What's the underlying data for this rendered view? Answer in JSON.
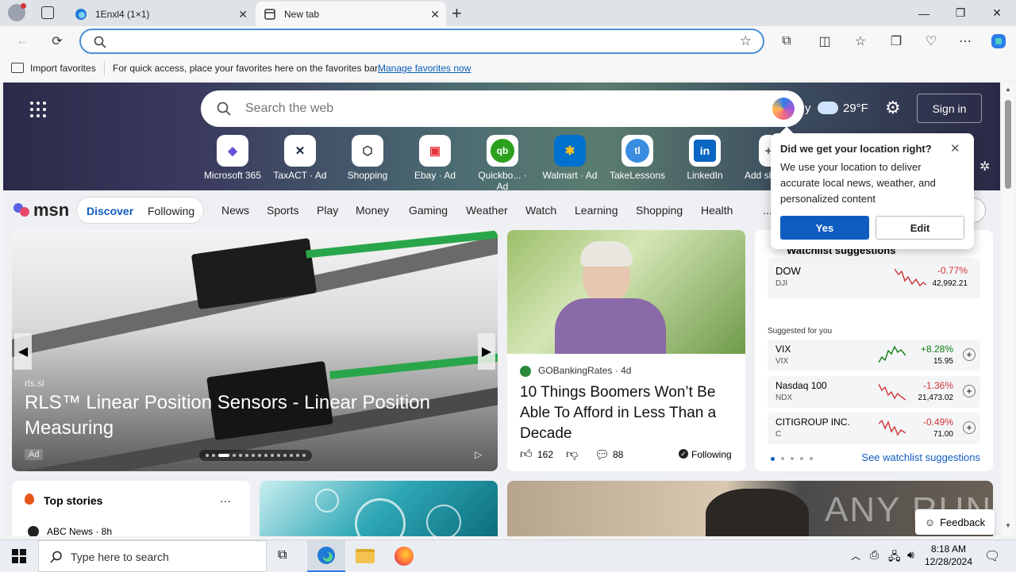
{
  "browser": {
    "tabs": [
      {
        "title": "1Enxl4 (1×1)",
        "active": false
      },
      {
        "title": "New tab",
        "active": true
      }
    ],
    "new_tab_symbol": "+",
    "window_controls": {
      "minimize": "—",
      "restore": "❐",
      "close": "✕"
    },
    "address": {
      "value": "",
      "placeholder": ""
    },
    "favorites_bar": {
      "import_label": "Import favorites",
      "hint": "For quick access, place your favorites here on the favorites bar.",
      "manage_link": "Manage favorites now"
    }
  },
  "msn": {
    "search_placeholder": "Search the web",
    "weather_text": "y",
    "temperature": "29°F",
    "sign_in": "Sign in",
    "quick_links": [
      {
        "label": "Microsoft 365",
        "icon": "microsoft-365-icon",
        "glyph": "◆",
        "color": "#6b4fd8"
      },
      {
        "label": "TaxACT · Ad",
        "icon": "taxact-icon",
        "glyph": "✕",
        "color": "#1b2a3f"
      },
      {
        "label": "Shopping",
        "icon": "shopping-tag-icon",
        "glyph": "⬡",
        "color": "#333333"
      },
      {
        "label": "Ebay · Ad",
        "icon": "ebay-icon",
        "glyph": "▣",
        "color": "#e53238"
      },
      {
        "label": "Quickbo... · Ad",
        "icon": "quickbooks-icon",
        "glyph": "qb",
        "color": "#2ca01c"
      },
      {
        "label": "Walmart · Ad",
        "icon": "walmart-icon",
        "glyph": "✱",
        "color": "#0071ce"
      },
      {
        "label": "TakeLessons",
        "icon": "takelessons-icon",
        "glyph": "tl",
        "color": "#3a8de0"
      },
      {
        "label": "LinkedIn",
        "icon": "linkedin-icon",
        "glyph": "in",
        "color": "#0a66c2"
      },
      {
        "label": "Add sh",
        "icon": "add-shortcut-icon",
        "glyph": "+",
        "color": "#555555"
      }
    ],
    "logo": "msn",
    "tabs": {
      "discover": "Discover",
      "following": "Following"
    },
    "nav": [
      "News",
      "Sports",
      "Play",
      "Money",
      "Gaming",
      "Weather",
      "Watch",
      "Learning",
      "Shopping",
      "Health"
    ],
    "nav_more": "...",
    "personalize_partial": "ze"
  },
  "location_popup": {
    "title": "Did we get your location right?",
    "body": "We use your location to deliver accurate local news, weather, and personalized content",
    "yes": "Yes",
    "edit": "Edit"
  },
  "hero_card": {
    "source": "rls.si",
    "title": "RLS™ Linear Position Sensors - Linear Position Measuring",
    "ad_label": "Ad",
    "dots_total": 15,
    "active_dot": 2
  },
  "article_card": {
    "source": "GOBankingRates",
    "age": "4d",
    "title": "10 Things Boomers Won’t Be Able To Afford in Less Than a Decade",
    "likes": "162",
    "comments": "88",
    "following": "Following"
  },
  "watchlist": {
    "header": "Watchlist suggestions",
    "main": {
      "name": "DOW",
      "ticker": "DJI",
      "change": "-0.77%",
      "price": "42,992.21",
      "color": "#d13438"
    },
    "suggested_label": "Suggested for you",
    "items": [
      {
        "name": "VIX",
        "ticker": "VIX",
        "change": "+8.28%",
        "price": "15.95",
        "color": "#107c10"
      },
      {
        "name": "Nasdaq 100",
        "ticker": "NDX",
        "change": "-1.36%",
        "price": "21,473.02",
        "color": "#d13438"
      },
      {
        "name": "CITIGROUP INC.",
        "ticker": "C",
        "change": "-0.49%",
        "price": "71.00",
        "color": "#d13438"
      }
    ],
    "see_more": "See watchlist suggestions"
  },
  "top_stories": {
    "title": "Top stories",
    "more": "···",
    "first_source": "ABC News · 8h"
  },
  "feedback": "Feedback",
  "watermark": "ANY RUN",
  "taskbar": {
    "search_placeholder": "Type here to search",
    "time": "8:18 AM",
    "date": "12/28/2024"
  }
}
